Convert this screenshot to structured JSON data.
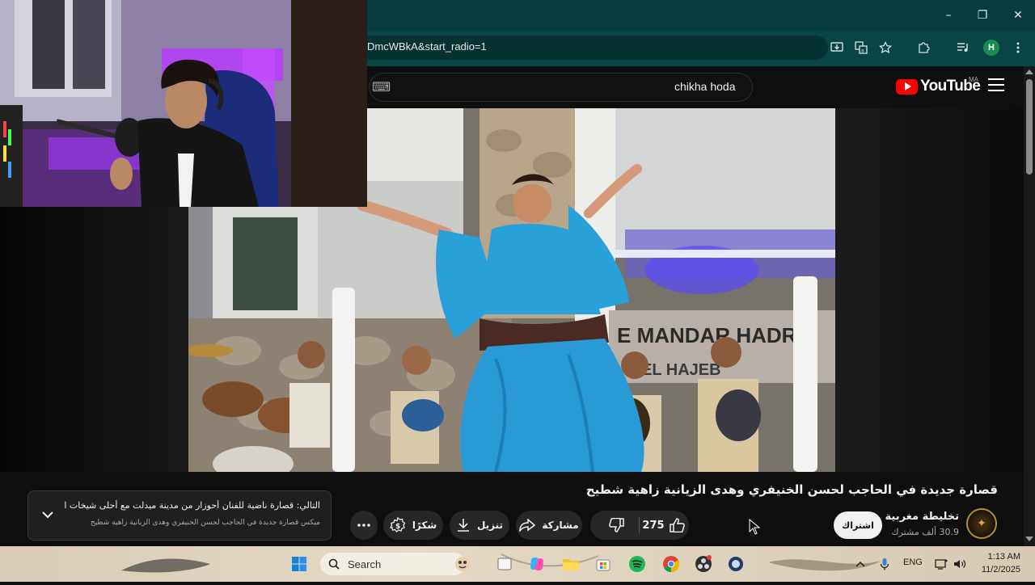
{
  "browser": {
    "url_fragment": "DmcWBkA&start_radio=1",
    "profile_initial": "H",
    "window_controls": {
      "minimize": "–",
      "maximize": "❐",
      "close": "✕"
    }
  },
  "youtube": {
    "search_query": "chikha hoda",
    "logo_text": "YouTube",
    "country_code": "MA",
    "video": {
      "title": "قصارة جديدة في الحاجب لحسن الخنيفري وهدى الزيانية زاهية شطيح",
      "channel_name": "تخليطة مغربية",
      "subscriber_count": "30.9 ألف مشترك",
      "subscribe_label": "اشتراك",
      "like_count": "275",
      "share_label": "مشاركة",
      "download_label": "تنزيل",
      "thanks_label": "شكرًا"
    },
    "up_next": {
      "line1": "التالي: قصارة ناضية للفنان أحوزار من مدينة ميدلت مع أحلى شيخات الأ...",
      "line2": "ميكس قصارة جديدة في الحاجب لحسن الخنيفري وهدى الزيانية زاهية شطيح"
    }
  },
  "taskbar": {
    "search_label": "Search",
    "language": "ENG",
    "time": "1:13 AM",
    "date": "11/2/2025"
  },
  "colors": {
    "chrome_title": "#073c3c",
    "youtube_red": "#ff0000",
    "dress_blue": "#2aa0d8",
    "rgb_purple": "#b83cff"
  }
}
